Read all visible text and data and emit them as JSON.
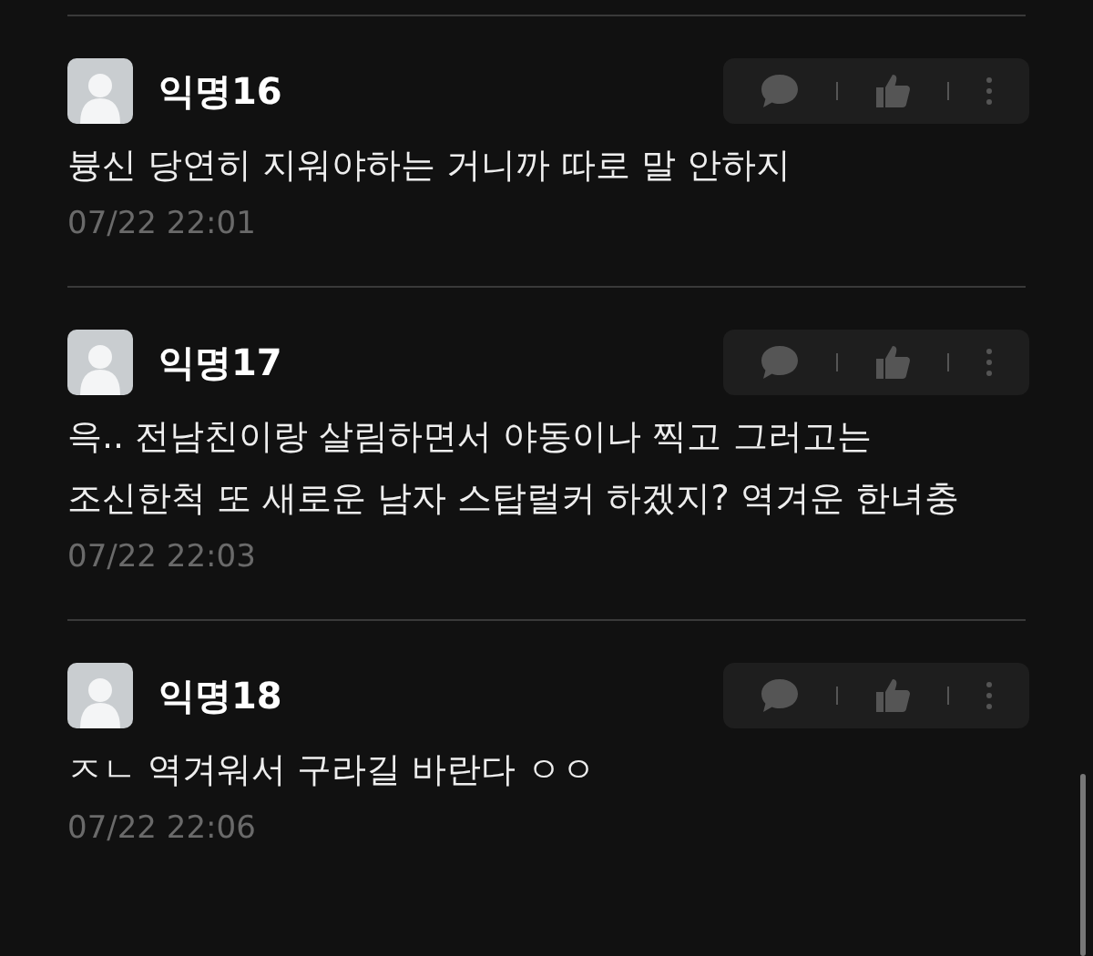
{
  "comments": [
    {
      "author": "익명16",
      "lines": [
        "븅신 당연히 지워야하는 거니까 따로 말 안하지"
      ],
      "time": "07/22 22:01"
    },
    {
      "author": "익명17",
      "lines": [
        "윽.. 전남친이랑 살림하면서 야동이나 찍고 그러고는",
        "조신한척 또 새로운 남자 스탑럴커 하겠지? 역겨운 한녀충"
      ],
      "time": "07/22 22:03"
    },
    {
      "author": "익명18",
      "lines": [
        "ㅈㄴ 역겨워서 구라길 바란다 ㅇㅇ"
      ],
      "time": "07/22 22:06"
    }
  ]
}
